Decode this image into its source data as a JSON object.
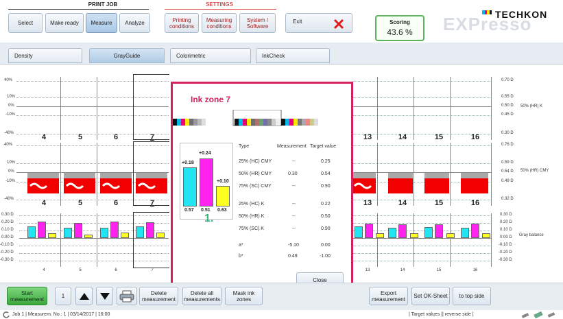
{
  "toolbar": {
    "print_job_label": "PRINT JOB",
    "settings_label": "SETTINGS",
    "buttons": {
      "select": "Select",
      "make_ready": "Make ready",
      "measure": "Measure",
      "analyze": "Analyze",
      "printing_conditions": "Printing conditions",
      "measuring_conditions": "Measuring conditions",
      "system_software": "System / Software",
      "exit": "Exit"
    },
    "scoring_label": "Scoring",
    "scoring_value": "43.6 %",
    "brand": "TECHKON",
    "brand_product": "EXPresso"
  },
  "tabs": {
    "density": "Density",
    "grayguide": "GrayGuide",
    "colorimetric": "Colorimetric",
    "inkcheck": "InkCheck"
  },
  "charts": {
    "top_left_labels": [
      "40%",
      "10%",
      "0%",
      "-10%",
      "-40%"
    ],
    "mid_left_labels": [
      "40%",
      "10%",
      "0%",
      "-10%",
      "-40%"
    ],
    "bottom_left_labels": [
      "0.30 D",
      "0.20 D",
      "0.10 D",
      "0.00 D",
      "-0.10 D",
      "-0.20 D",
      "-0.30 D"
    ],
    "top_right_labels": [
      "0.70 D",
      "0.55 D",
      "0.50 D",
      "0.45 D",
      "0.30 D"
    ],
    "mid_right_labels": [
      "0.76 D",
      "0.59 D",
      "0.54 D",
      "0.49 D",
      "0.32 D"
    ],
    "bottom_right_labels": [
      "0.30 D",
      "0.20 D",
      "0.10 D",
      "0.00 D",
      "-0.10 D",
      "-0.20 D",
      "-0.30 D"
    ],
    "top_caption": "50% (HR) K",
    "mid_caption": "50% (HR) CMY",
    "bottom_caption": "Gray balance",
    "zones_left": [
      "4",
      "5",
      "6",
      "7"
    ],
    "zones_right": [
      "13",
      "14",
      "15",
      "16"
    ]
  },
  "popup": {
    "title": "Ink zone 7",
    "bar_values": [
      "+0.18",
      "+0.24",
      "+0.10"
    ],
    "bar_bottom_values": [
      "0.57",
      "0.51",
      "0.63"
    ],
    "score_digit": "1.",
    "table_header": {
      "type": "Type",
      "measurement": "Measurement",
      "target": "Target value"
    },
    "rows": [
      {
        "type": "25% (HC) CMY",
        "measurement": "--",
        "target": "0.25"
      },
      {
        "type": "50% (HR) CMY",
        "measurement": "0.30",
        "target": "0.54"
      },
      {
        "type": "75% (SC) CMY",
        "measurement": "--",
        "target": "0.90"
      },
      {
        "type": "25% (HC) K",
        "measurement": "--",
        "target": "0.22"
      },
      {
        "type": "50% (HR) K",
        "measurement": "--",
        "target": "0.50"
      },
      {
        "type": "75% (SC) K",
        "measurement": "--",
        "target": "0.90"
      },
      {
        "type": "a*",
        "measurement": "-5.10",
        "target": "0.00"
      },
      {
        "type": "b*",
        "measurement": "0.49",
        "target": "-1.00"
      }
    ],
    "close": "Close"
  },
  "bottom": {
    "start_measurement": "Start measurement",
    "page_number": "1",
    "delete_measurement": "Delete measurement",
    "delete_all_measurements": "Delete all measurements",
    "mask_ink_zones": "Mask ink zones",
    "export_measurement": "Export measurement",
    "set_ok_sheet": "Set OK-Sheet",
    "to_top_side": "to top side"
  },
  "status": {
    "job": "Job 1 | Measurem. No.: 1 | 03/14/2017 | 16:00",
    "right": "| Target values || reverse side |"
  },
  "colors": {
    "accent": "#d6205a",
    "cyan": "#22e4f2",
    "magenta": "#ff22ee",
    "yellow": "#ffff22",
    "red": "#f20000",
    "scoring_border": "#58b35a"
  }
}
